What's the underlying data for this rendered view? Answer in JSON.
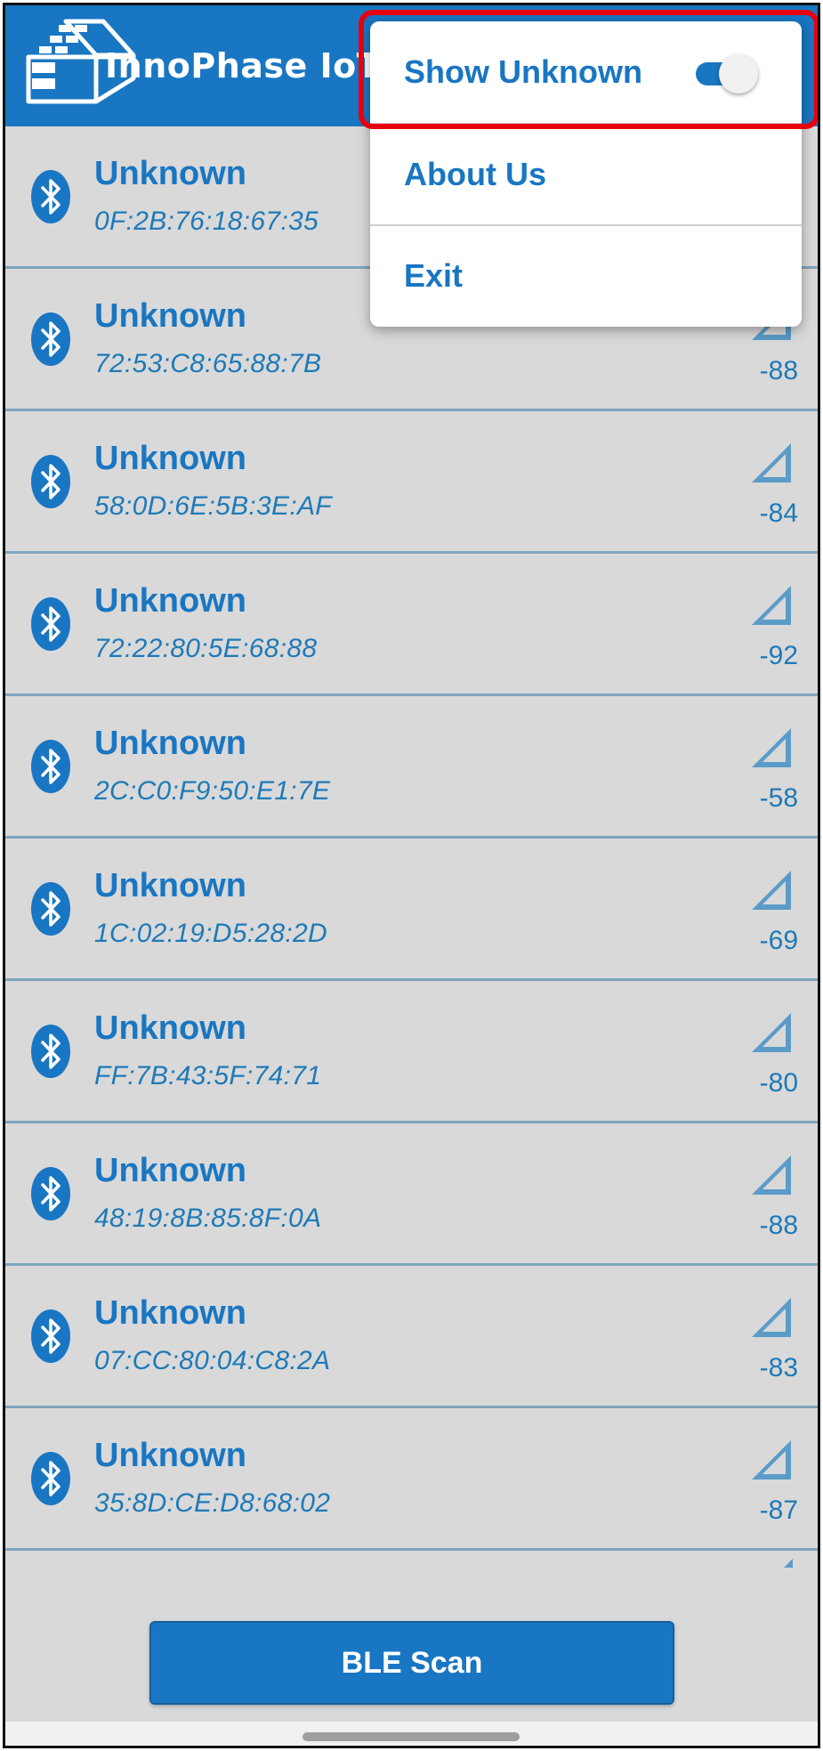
{
  "app": {
    "title": "InnoPhase IoT",
    "brand_color": "#1976c2"
  },
  "menu": {
    "show_unknown": {
      "label": "Show Unknown",
      "toggle_on": true
    },
    "about_label": "About Us",
    "exit_label": "Exit"
  },
  "devices": [
    {
      "name": "Unknown",
      "mac": "0F:2B:76:18:67:35",
      "rssi": ""
    },
    {
      "name": "Unknown",
      "mac": "72:53:C8:65:88:7B",
      "rssi": "-88"
    },
    {
      "name": "Unknown",
      "mac": "58:0D:6E:5B:3E:AF",
      "rssi": "-84"
    },
    {
      "name": "Unknown",
      "mac": "72:22:80:5E:68:88",
      "rssi": "-92"
    },
    {
      "name": "Unknown",
      "mac": "2C:C0:F9:50:E1:7E",
      "rssi": "-58"
    },
    {
      "name": "Unknown",
      "mac": "1C:02:19:D5:28:2D",
      "rssi": "-69"
    },
    {
      "name": "Unknown",
      "mac": "FF:7B:43:5F:74:71",
      "rssi": "-80"
    },
    {
      "name": "Unknown",
      "mac": "48:19:8B:85:8F:0A",
      "rssi": "-88"
    },
    {
      "name": "Unknown",
      "mac": "07:CC:80:04:C8:2A",
      "rssi": "-83"
    },
    {
      "name": "Unknown",
      "mac": "35:8D:CE:D8:68:02",
      "rssi": "-87"
    }
  ],
  "icons": {
    "device": "bluetooth-icon",
    "signal": "signal-strength-icon"
  },
  "footer": {
    "scan_button_label": "BLE Scan"
  }
}
